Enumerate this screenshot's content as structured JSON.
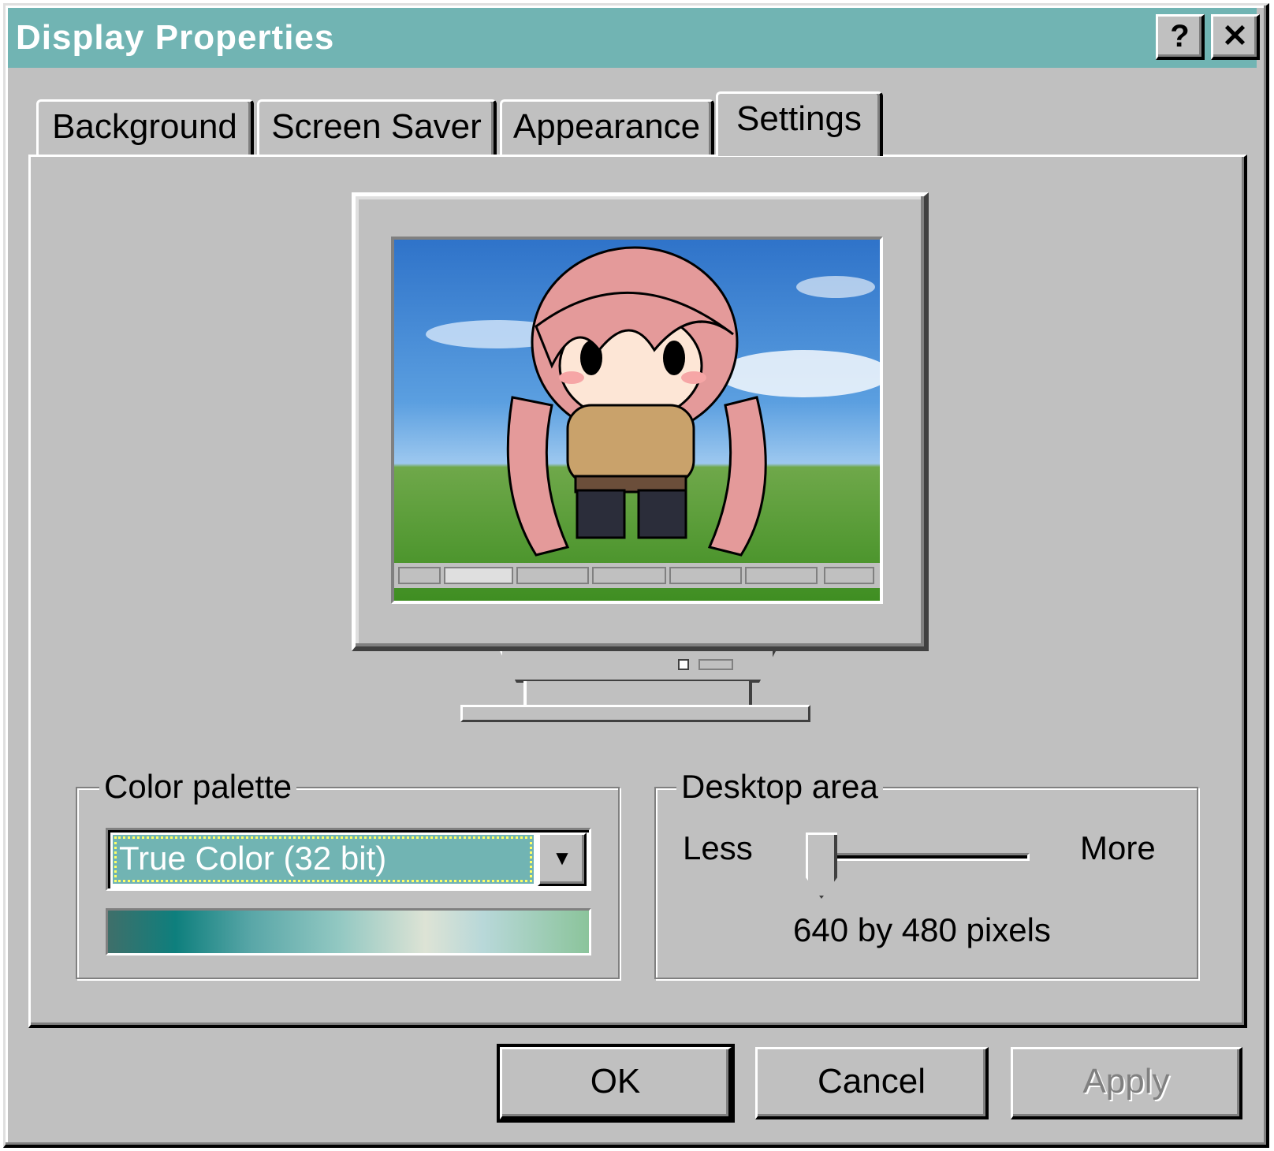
{
  "window": {
    "title": "Display Properties",
    "help_label": "?",
    "close_label": "✕"
  },
  "tabs": [
    {
      "label": "Background",
      "active": false
    },
    {
      "label": "Screen Saver",
      "active": false
    },
    {
      "label": "Appearance",
      "active": false
    },
    {
      "label": "Settings",
      "active": true
    }
  ],
  "preview": {
    "icon": "monitor-preview-with-wallpaper"
  },
  "color_palette": {
    "label": "Color palette",
    "selected": "True Color (32 bit)",
    "dropdown_icon": "chevron-down-icon"
  },
  "desktop_area": {
    "label": "Desktop area",
    "less_label": "Less",
    "more_label": "More",
    "resolution": "640 by 480 pixels",
    "slider_level": 0
  },
  "buttons": {
    "ok": "OK",
    "cancel": "Cancel",
    "apply": "Apply"
  },
  "colors": {
    "titlebar": "#71b4b3",
    "face": "#c0c0c0",
    "selection": "#71b4b3"
  }
}
